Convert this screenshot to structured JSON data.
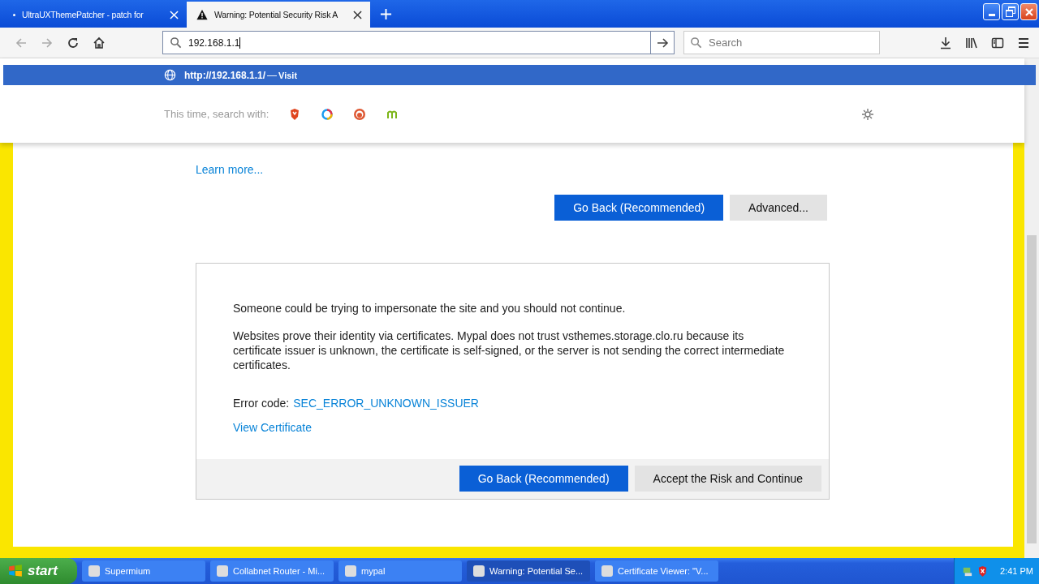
{
  "tabs": [
    {
      "title": "UltraUXThemePatcher - patch for",
      "selected": false
    },
    {
      "title": "Warning: Potential Security Risk A",
      "selected": true
    }
  ],
  "address_bar": {
    "value": "192.168.1.1"
  },
  "search_field": {
    "placeholder": "Search"
  },
  "url_suggestion": {
    "url": "http://192.168.1.1/",
    "separator": "—",
    "action": "Visit"
  },
  "search_with": {
    "label": "This time, search with:"
  },
  "page": {
    "learn_more": "Learn more...",
    "buttons": [
      {
        "label": "Go Back (Recommended)",
        "kind": "primary"
      },
      {
        "label": "Advanced...",
        "kind": "secondary"
      }
    ],
    "details": {
      "paragraphs": [
        "Someone could be trying to impersonate the site and you should not continue.",
        "Websites prove their identity via certificates. Mypal does not trust vsthemes.storage.clo.ru because its certificate issuer is unknown, the certificate is self-signed, or the server is not sending the correct intermediate certificates."
      ],
      "error_label": "Error code:",
      "error_code": "SEC_ERROR_UNKNOWN_ISSUER",
      "view_certificate": "View Certificate",
      "buttons": [
        {
          "label": "Go Back (Recommended)",
          "kind": "primary"
        },
        {
          "label": "Accept the Risk and Continue",
          "kind": "secondary"
        }
      ]
    }
  },
  "taskbar": {
    "start": "start",
    "items": [
      {
        "label": "Supermium",
        "selected": false
      },
      {
        "label": "Collabnet Router - Mi...",
        "selected": false
      },
      {
        "label": "mypal",
        "selected": false
      },
      {
        "label": "Warning: Potential Se...",
        "selected": true
      },
      {
        "label": "Certificate Viewer: \"V...",
        "selected": false
      }
    ],
    "clock": "2:41 PM"
  }
}
